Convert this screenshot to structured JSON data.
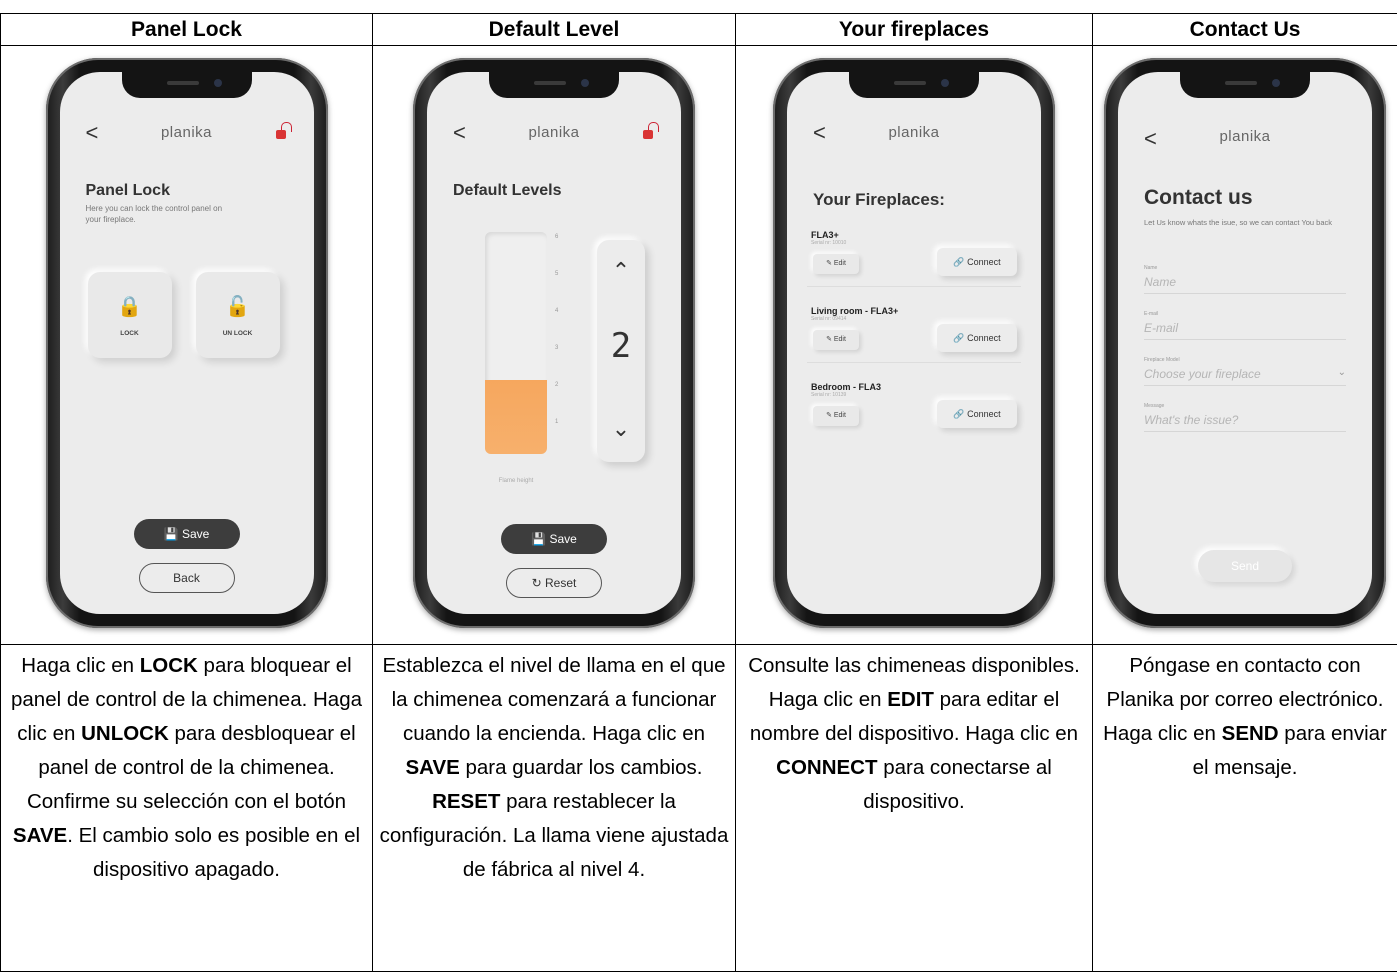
{
  "columns": [
    {
      "heading": "Panel Lock"
    },
    {
      "heading": "Default Level"
    },
    {
      "heading": "Your fireplaces"
    },
    {
      "heading": "Contact Us"
    }
  ],
  "app": {
    "brand": "planika",
    "back": "<"
  },
  "panel_lock": {
    "title": "Panel Lock",
    "subtitle": "Here you can lock the control panel on your fireplace.",
    "lock_label": "LOCK",
    "unlock_label": "UN LOCK",
    "save_label": "Save",
    "back_label": "Back"
  },
  "default_level": {
    "title": "Default Levels",
    "ticks": [
      "6",
      "5",
      "4",
      "3",
      "2",
      "1"
    ],
    "level_value": 2,
    "level_max": 6,
    "display": "2",
    "flame_label": "Flame height",
    "save_label": "Save",
    "reset_label": "Reset"
  },
  "fireplaces": {
    "title": "Your Fireplaces:",
    "items": [
      {
        "name": "FLA3+",
        "serial": "Serial nr: 10010",
        "edit": "Edit",
        "connect": "Connect"
      },
      {
        "name": "Living room - FLA3+",
        "serial": "Serial nr: 09414",
        "edit": "Edit",
        "connect": "Connect"
      },
      {
        "name": "Bedroom - FLA3",
        "serial": "Serial nr: 10139",
        "edit": "Edit",
        "connect": "Connect"
      }
    ]
  },
  "contact": {
    "title": "Contact us",
    "subtitle": "Let Us know whats the isue, so we can contact You back",
    "fields": [
      {
        "label": "Name",
        "placeholder": "Name"
      },
      {
        "label": "E-mail",
        "placeholder": "E-mail"
      },
      {
        "label": "Fireplace Model",
        "placeholder": "Choose your fireplace"
      },
      {
        "label": "Message",
        "placeholder": "What's the issue?"
      }
    ],
    "send_label": "Send"
  },
  "descriptions": {
    "lock": [
      "Haga clic en ",
      "LOCK",
      " para bloquear el panel de control de la chimenea. Haga clic en ",
      "UNLOCK",
      " para desbloquear el panel de control de la chimenea. Confirme su selección con el botón ",
      "SAVE",
      ". El cambio solo es posible en el dispositivo apagado."
    ],
    "level": [
      "Establezca el nivel de llama en el que la chimenea comenzará a funcionar cuando la encienda. Haga clic en ",
      "SAVE",
      " para guardar los cambios. ",
      "RESET",
      " para restablecer la configuración. La llama viene ajustada de fábrica al nivel 4."
    ],
    "fireplaces": [
      "Consulte las chimeneas disponibles. Haga clic en ",
      "EDIT",
      " para editar el nombre del dispositivo. Haga clic en ",
      "CONNECT",
      " para conectarse al dispositivo."
    ],
    "contact": [
      "Póngase en contacto con Planika por correo electrónico. Haga clic en ",
      "SEND",
      " para enviar el mensaje."
    ]
  }
}
